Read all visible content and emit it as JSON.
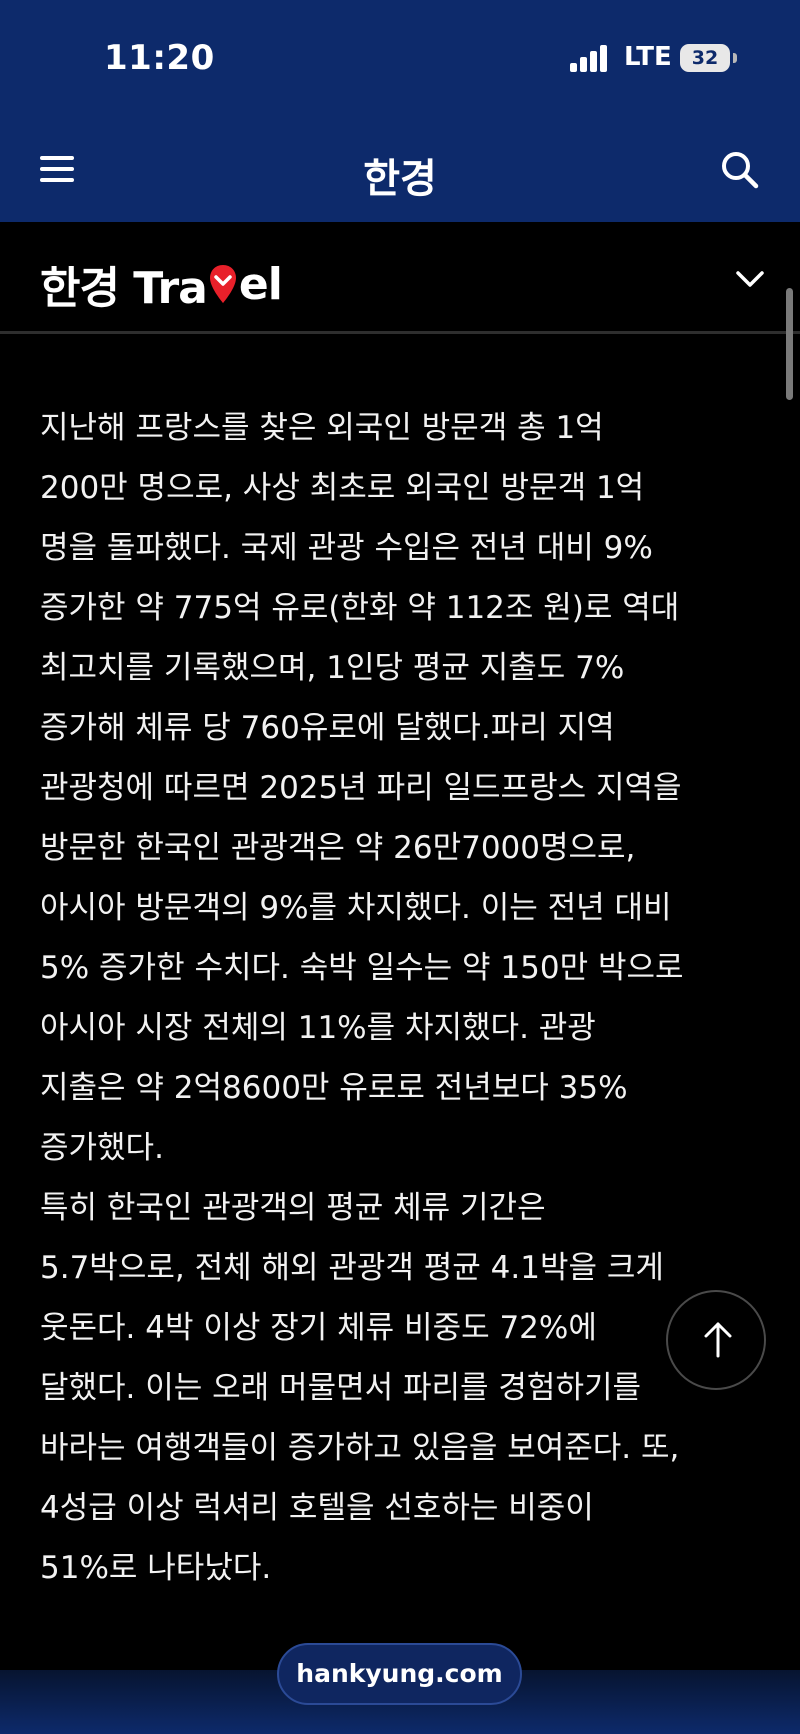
{
  "status_bar": {
    "time": "11:20",
    "network": "LTE",
    "battery": "32"
  },
  "header": {
    "brand": "한경",
    "menu_icon": "hamburger-menu-icon",
    "search_icon": "search-icon"
  },
  "section": {
    "title_prefix": "한경 Tra",
    "title_suffix": "el",
    "logo_icon": "location-pin-icon",
    "toggle_icon": "chevron-down-icon",
    "accent_color": "#e8202a"
  },
  "article": {
    "lines": [
      "지난해 프랑스를 찾은 외국인 방문객 총 1억",
      "200만 명으로, 사상 최초로 외국인 방문객 1억",
      "명을 돌파했다. 국제 관광 수입은 전년 대비 9%",
      "증가한 약 775억 유로(한화 약 112조 원)로 역대",
      "최고치를 기록했으며, 1인당 평균 지출도 7%",
      "증가해 체류 당 760유로에 달했다.파리 지역",
      "관광청에 따르면 2025년 파리 일드프랑스 지역을",
      "방문한 한국인 관광객은 약 26만7000명으로,",
      "아시아 방문객의 9%를 차지했다. 이는 전년 대비",
      "5% 증가한 수치다. 숙박 일수는 약 150만 박으로",
      "아시아 시장 전체의 11%를 차지했다. 관광",
      "지출은 약 2억8600만 유로로 전년보다 35%",
      "증가했다.",
      "특히 한국인 관광객의 평균 체류 기간은",
      "5.7박으로, 전체 해외 관광객 평균 4.1박을 크게",
      "웃돈다. 4박 이상 장기 체류 비중도 72%에",
      "달했다. 이는 오래 머물면서 파리를 경험하기를",
      "바라는 여행객들이 증가하고 있음을 보여준다. 또,",
      "4성급 이상 럭셔리 호텔을 선호하는 비중이",
      "51%로 나타났다."
    ]
  },
  "floating": {
    "scroll_top_icon": "arrow-up-icon"
  },
  "footer": {
    "url": "hankyung.com"
  },
  "colors": {
    "header_bg": "#0d2a6b",
    "page_bg": "#000000",
    "text": "#f2f2f2"
  }
}
